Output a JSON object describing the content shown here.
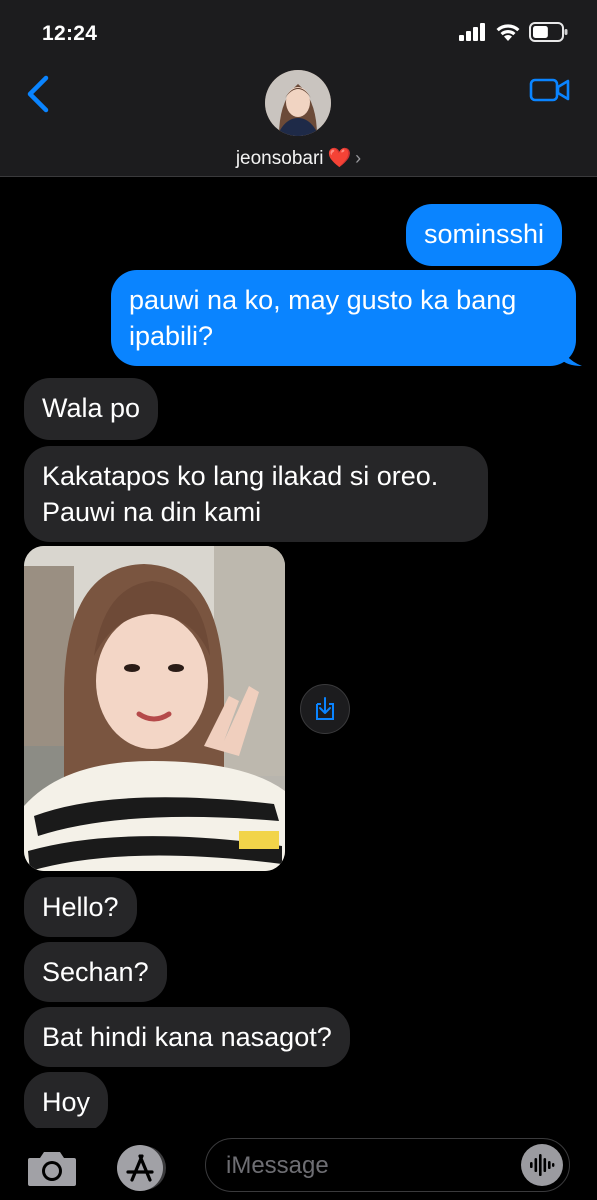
{
  "status_bar": {
    "time": "12:24",
    "battery_level": 0.55
  },
  "header": {
    "contact_name": "jeonsobari",
    "contact_emoji": "❤️",
    "back_icon": "chevron-left-icon",
    "video_icon": "video-camera-icon"
  },
  "messages": [
    {
      "from": "me",
      "text": "sominsshi"
    },
    {
      "from": "me",
      "text": "pauwi na ko, may gusto ka bang ipabili?"
    },
    {
      "from": "them",
      "text": "Wala po"
    },
    {
      "from": "them",
      "text": "Kakatapos ko lang ilakad si oreo. Pauwi na din kami"
    },
    {
      "from": "them",
      "type": "photo"
    },
    {
      "from": "them",
      "text": "Hello?"
    },
    {
      "from": "them",
      "text": "Sechan?"
    },
    {
      "from": "them",
      "text": "Bat hindi kana nasagot?"
    },
    {
      "from": "them",
      "text": "Hoy"
    }
  ],
  "input_bar": {
    "placeholder": "iMessage",
    "camera_icon": "camera-icon",
    "apps_icon": "app-store-icon",
    "audio_icon": "audio-waveform-icon"
  },
  "colors": {
    "sent_bubble": "#0a84ff",
    "received_bubble": "#262628",
    "accent": "#0a84ff",
    "background": "#000000"
  }
}
